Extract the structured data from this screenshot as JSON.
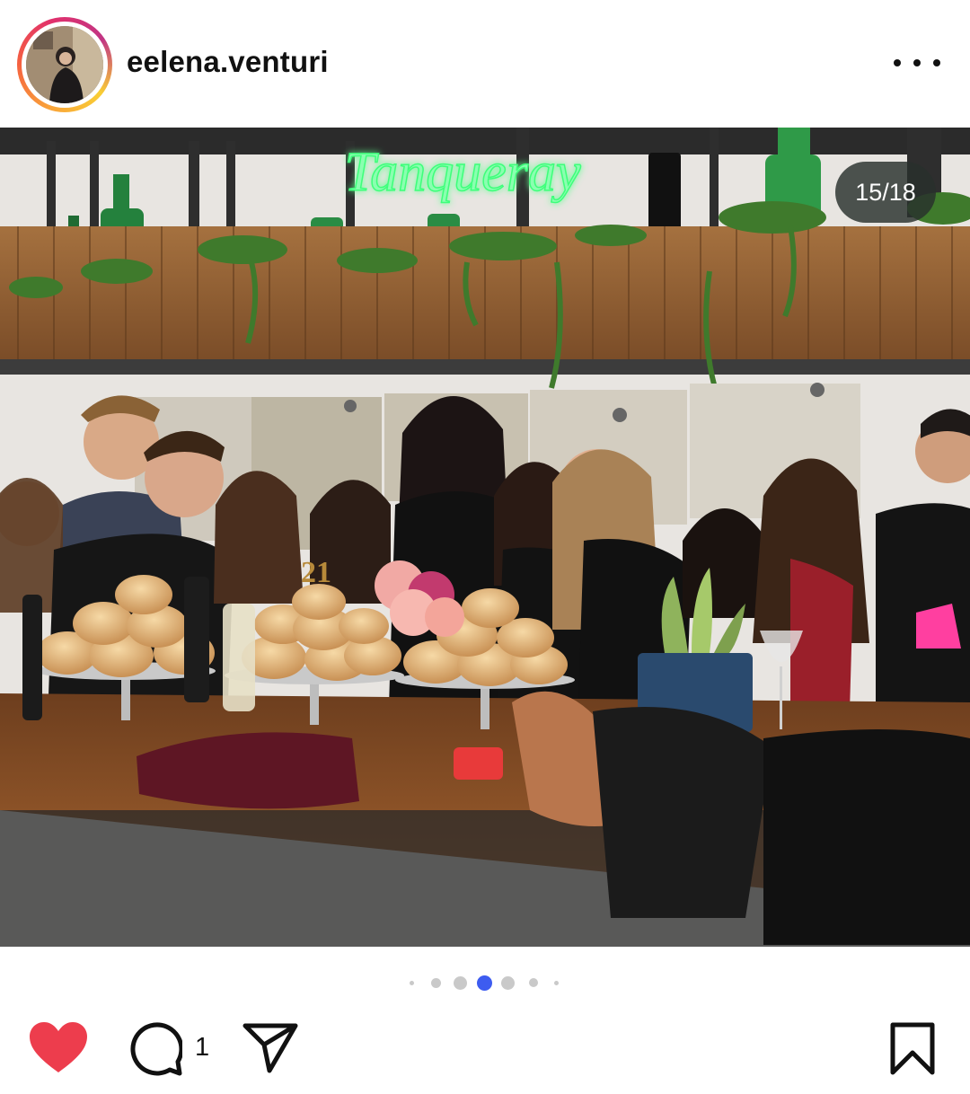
{
  "post": {
    "username": "eelena.venturi",
    "media_counter": "15/18",
    "current_slide": 15,
    "total_slides": 18,
    "liked": true,
    "comment_count": "1",
    "saved": false,
    "photo_sign_text": "Tanqueray",
    "candle_text": "21"
  },
  "colors": {
    "like_red": "#ed3d4d",
    "active_dot": "#3d5cf0",
    "neon_green": "#3dff7a"
  },
  "icons": {
    "like": "heart-icon",
    "comment": "comment-bubble-icon",
    "share": "paper-plane-icon",
    "save": "bookmark-icon",
    "more": "more-dots-icon"
  }
}
